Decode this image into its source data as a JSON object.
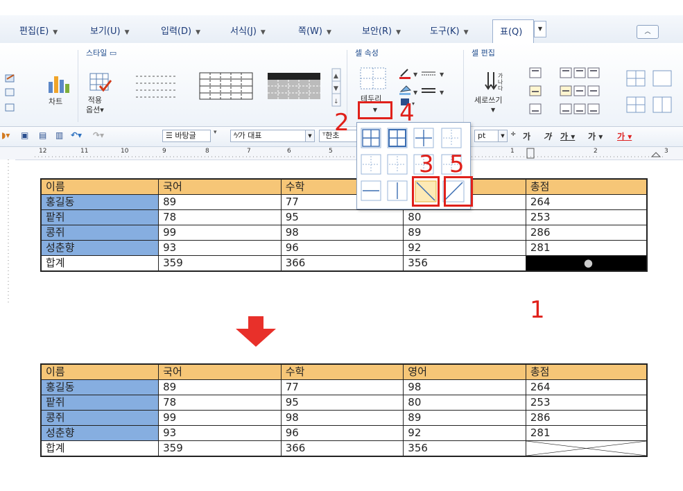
{
  "menu": {
    "items": [
      {
        "label": "편집(E)"
      },
      {
        "label": "보기(U)"
      },
      {
        "label": "입력(D)"
      },
      {
        "label": "서식(J)"
      },
      {
        "label": "쪽(W)"
      },
      {
        "label": "보안(R)"
      },
      {
        "label": "도구(K)"
      }
    ],
    "active_tab": "표(Q)"
  },
  "ribbon": {
    "style_group_label": "스타일",
    "chart_label": "차트",
    "apply_option_label": "적용\n옵션",
    "cell_props_group": "셀 속성",
    "cell_edit_group": "셀 편집",
    "border_button_label": "테두리",
    "vertical_text_label": "세로쓰기"
  },
  "toolbar": {
    "font_combo": "바탕글",
    "style_combo": "대표",
    "font_name_partial": "한초",
    "unit": "pt",
    "format_glyphs": [
      "가",
      "가",
      "가",
      "가",
      "가"
    ]
  },
  "ruler": {
    "numbers": [
      "12",
      "11",
      "10",
      "9",
      "8",
      "7",
      "6",
      "5",
      "1",
      "2",
      "3"
    ]
  },
  "table": {
    "headers": [
      "이름",
      "국어",
      "수학",
      "영어",
      "총점"
    ],
    "rows": [
      [
        "홍길동",
        "89",
        "77",
        "98",
        "264"
      ],
      [
        "팥쥐",
        "78",
        "95",
        "80",
        "253"
      ],
      [
        "콩쥐",
        "99",
        "98",
        "89",
        "286"
      ],
      [
        "성춘향",
        "93",
        "96",
        "92",
        "281"
      ],
      [
        "합계",
        "359",
        "366",
        "356",
        ""
      ]
    ]
  },
  "annotations": {
    "step1": "1",
    "step2": "2",
    "step3": "3",
    "step4": "4",
    "step5": "5"
  },
  "colors": {
    "header_fill": "#f6c677",
    "name_fill": "#86aee0",
    "highlight_red": "#e0201a",
    "selected_cell": "#000000"
  }
}
